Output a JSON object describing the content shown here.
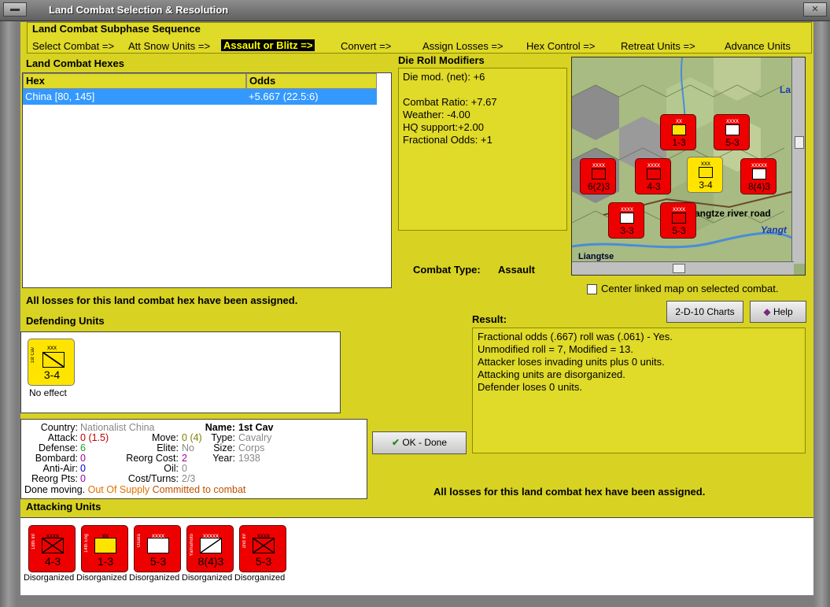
{
  "window": {
    "title": "Land Combat Selection & Resolution"
  },
  "sequence": {
    "title": "Land Combat Subphase Sequence",
    "steps": [
      "Select Combat =>",
      "Att Snow Units =>",
      "Assault or Blitz =>",
      "Convert =>",
      "Assign Losses =>",
      "Hex Control =>",
      "Retreat Units =>",
      "Advance Units"
    ]
  },
  "hexes": {
    "title": "Land Combat Hexes",
    "headers": [
      "Hex",
      "Odds"
    ],
    "rows": [
      {
        "hex": "China [80, 145]",
        "odds": "+5.667 (22.5:6)"
      }
    ]
  },
  "modifiers": {
    "title": "Die Roll Modifiers",
    "lines": [
      "Die mod. (net): +6",
      "",
      "Combat Ratio: +7.67",
      "Weather: -4.00",
      "HQ support:+2.00",
      "Fractional Odds: +1"
    ]
  },
  "map": {
    "labels": {
      "liangtse": "Liangtse",
      "yangtze_river": "angtze river road",
      "yangt": "Yangt",
      "la": "La"
    },
    "units": [
      {
        "name": "Osaka",
        "size": "xx",
        "value": "1-3",
        "type": "engineer"
      },
      {
        "name": "Osaka",
        "size": "xxxx",
        "value": "5-3",
        "type": "mech"
      },
      {
        "name": "",
        "size": "xxxx",
        "value": "6(2)3",
        "type": "inf"
      },
      {
        "name": "",
        "size": "xxxx",
        "value": "4-3",
        "type": "inf"
      },
      {
        "name": "1st Cav",
        "size": "xxx",
        "value": "3-4",
        "type": "cav"
      },
      {
        "name": "Yamamoto",
        "size": "xxxxx",
        "value": "8(4)3",
        "type": "inf"
      },
      {
        "name": "",
        "size": "xxxx",
        "value": "3-3",
        "type": "inf"
      },
      {
        "name": "",
        "size": "xxxx",
        "value": "5-3",
        "type": "inf"
      }
    ]
  },
  "center_map": {
    "label": "Center linked map on selected combat."
  },
  "combat_type": {
    "label": "Combat Type:",
    "value": "Assault"
  },
  "losses_msg_top": "All losses for this land combat hex have been assigned.",
  "losses_msg_bottom": "All losses for this land combat hex have been assigned.",
  "defending": {
    "title": "Defending Units",
    "units": [
      {
        "name": "1st Cav",
        "size": "xxx",
        "value": "3-4",
        "status": "No effect"
      }
    ]
  },
  "buttons": {
    "charts": "2-D-10 Charts",
    "help": "Help",
    "ok": "OK - Done"
  },
  "result": {
    "title": "Result:",
    "lines": [
      "Fractional odds (.667) roll was (.061)  - Yes.",
      "Unmodified roll = 7, Modified = 13.",
      "Attacker loses invading units plus 0 units.",
      "Attacking units are disorganized.",
      "Defender loses 0 units."
    ]
  },
  "unit_info": {
    "country_label": "Country:",
    "country": "Nationalist China",
    "attack_label": "Attack:",
    "attack": "0",
    "attack_extra": "(1.5)",
    "defense_label": "Defense:",
    "defense": "6",
    "bombard_label": "Bombard:",
    "bombard": "0",
    "antiair_label": "Anti-Air:",
    "antiair": "0",
    "reorg_pts_label": "Reorg Pts:",
    "reorg_pts": "0",
    "move_label": "Move:",
    "move": "0",
    "move_extra": "(4)",
    "elite_label": "Elite:",
    "elite": "No",
    "reorg_cost_label": "Reorg Cost:",
    "reorg_cost": "2",
    "oil_label": "Oil:",
    "oil": "0",
    "cost_label": "Cost/Turns:",
    "cost": "2/3",
    "name_label": "Name:",
    "name": "1st Cav",
    "type_label": "Type:",
    "type": "Cavalry",
    "size_label": "Size:",
    "size": "Corps",
    "year_label": "Year:",
    "year": "1938",
    "status1": "Done moving.",
    "status2": "Out Of Supply",
    "status3": "Committed to combat"
  },
  "attacking": {
    "title": "Attacking Units",
    "units": [
      {
        "name": "18th Inf",
        "size": "xxxx",
        "value": "4-3",
        "status": "Disorganized",
        "type": "inf"
      },
      {
        "name": "14th Eng",
        "size": "xx",
        "value": "1-3",
        "status": "Disorganized",
        "type": "engineer"
      },
      {
        "name": "Osaka",
        "size": "xxxx",
        "value": "5-3",
        "status": "Disorganized",
        "type": "mech"
      },
      {
        "name": "Yamamoto",
        "size": "xxxxx",
        "value": "8(4)3",
        "status": "Disorganized",
        "type": "inf"
      },
      {
        "name": "2nd Inf",
        "size": "xxxx",
        "value": "5-3",
        "status": "Disorganized",
        "type": "inf"
      }
    ]
  },
  "colors": {
    "panel": "#d8d222",
    "unit_red": "#e00000",
    "unit_yellow": "#ffe400",
    "selected": "#3399ff"
  }
}
